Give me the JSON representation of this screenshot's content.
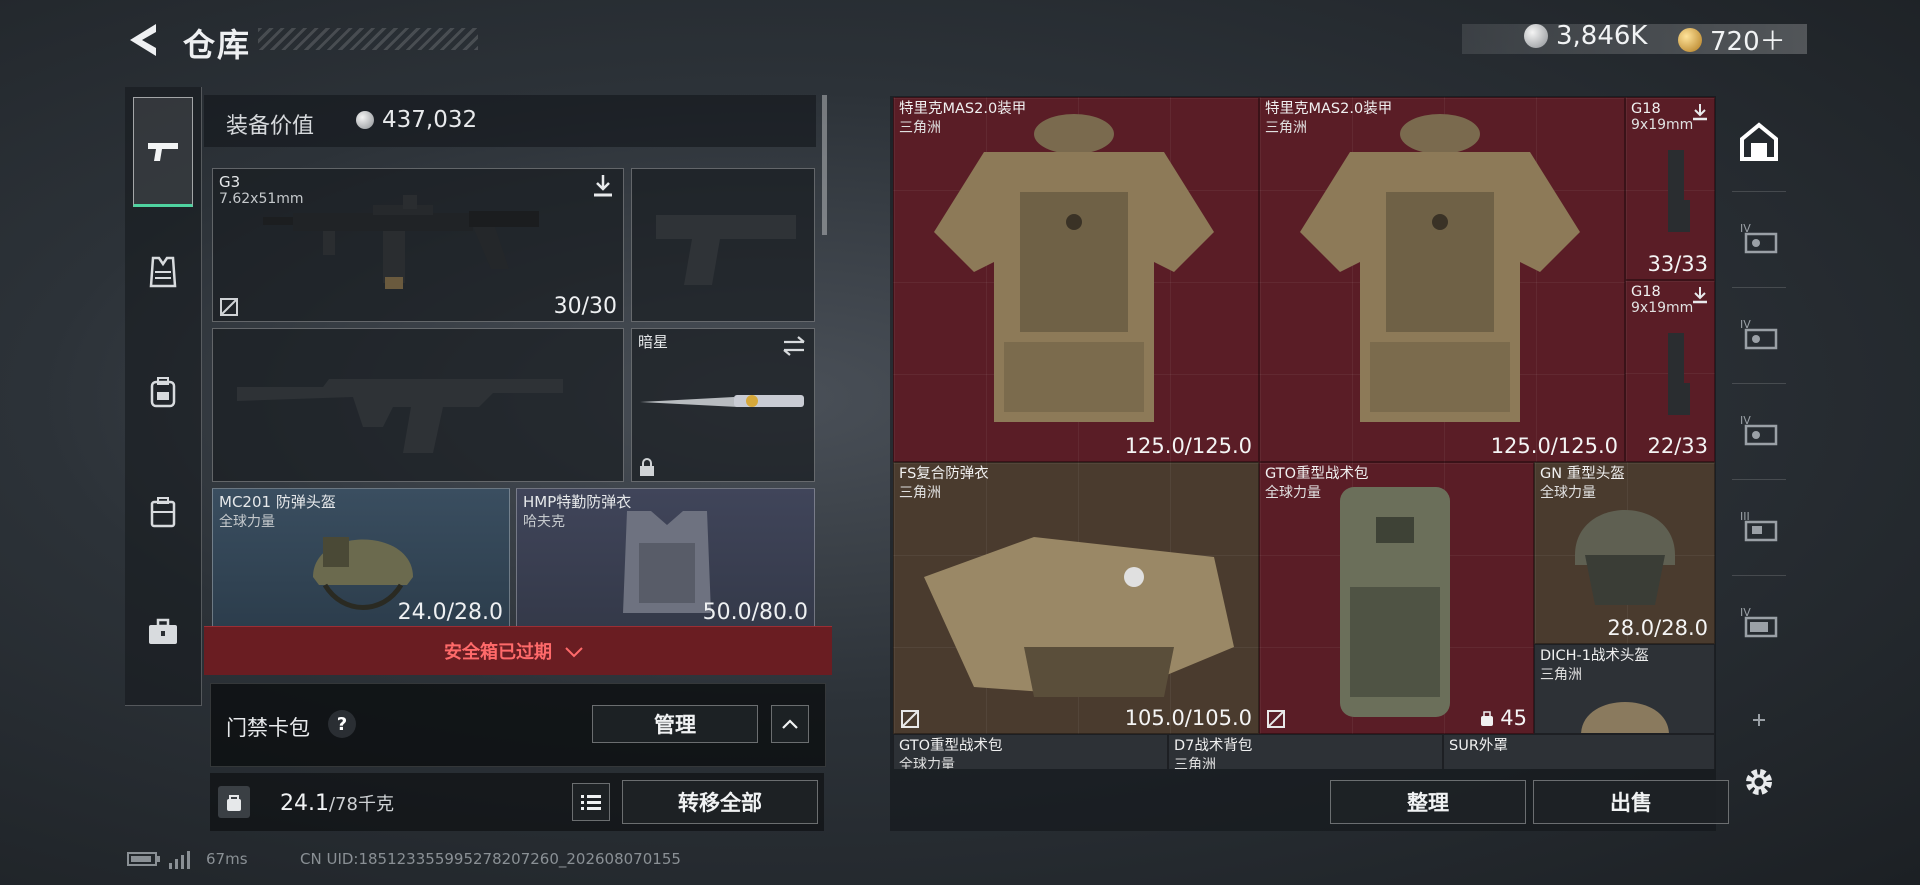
{
  "header": {
    "title": "仓库"
  },
  "currency": {
    "primary": "3,846K",
    "secondary": "720＋"
  },
  "equipment": {
    "value_label": "装备价值",
    "value": "437,032",
    "slots": {
      "primary": {
        "name": "G3",
        "caliber": "7.62x51mm",
        "count": "30/30"
      },
      "melee": {
        "name": "暗星"
      },
      "helmet": {
        "name": "MC201 防弹头盔",
        "brand": "全球力量",
        "count": "24.0/28.0"
      },
      "armor": {
        "name": "HMP特勤防弹衣",
        "brand": "哈夫克",
        "count": "50.0/80.0"
      }
    },
    "expired_text": "安全箱已过期",
    "keycard_label": "门禁卡包",
    "keycard_help": "?",
    "manage_label": "管理",
    "weight": "24.1",
    "weight_cap": "/78千克",
    "transfer_all_label": "转移全部"
  },
  "stash": {
    "items": [
      {
        "name": "特里克MAS2.0装甲",
        "brand": "三角洲",
        "count": "125.0/125.0"
      },
      {
        "name": "特里克MAS2.0装甲",
        "brand": "三角洲",
        "count": "125.0/125.0"
      },
      {
        "name": "G18",
        "brand": "9x19mm",
        "count": "33/33"
      },
      {
        "name": "G18",
        "brand": "9x19mm",
        "count": "22/33"
      },
      {
        "name": "FS复合防弹衣",
        "brand": "三角洲",
        "count": "105.0/105.0"
      },
      {
        "name": "GTO重型战术包",
        "brand": "全球力量",
        "count": "45"
      },
      {
        "name": "GN 重型头盔",
        "brand": "全球力量",
        "count": "28.0/28.0"
      },
      {
        "name": "DICH-1战术头盔",
        "brand": "三角洲",
        "count": ""
      },
      {
        "name": "GTO重型战术包",
        "brand": "全球力量",
        "count": ""
      },
      {
        "name": "D7战术背包",
        "brand": "三角洲",
        "count": ""
      },
      {
        "name": "SUR外罩",
        "brand": "",
        "count": ""
      }
    ],
    "sort_label": "整理",
    "sell_label": "出售"
  },
  "status": {
    "ping": "67ms",
    "uid": "CN UID:185123355995278207260_202608070155"
  }
}
